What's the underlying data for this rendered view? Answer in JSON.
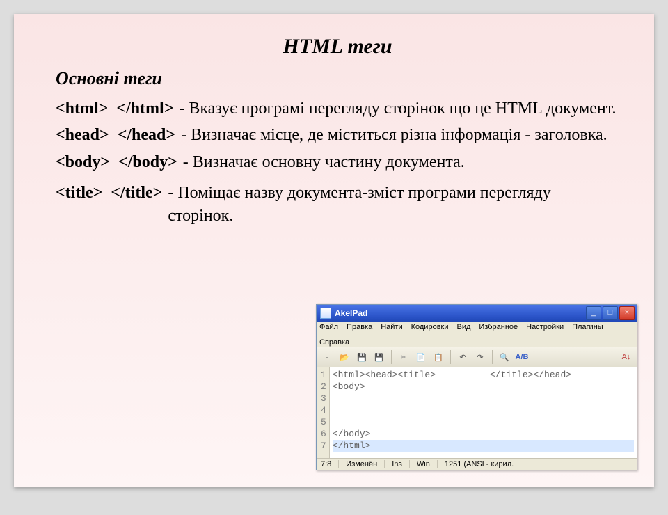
{
  "title": "HTML теги",
  "subtitle": "Основні теги",
  "items": [
    {
      "tags": "<html>  </html>",
      "desc": "- Вказує програмі перегляду сторінок що це HTML документ."
    },
    {
      "tags": "<head>  </head>",
      "desc": "- Визначає місце, де міститься різна інформація - заголовка."
    },
    {
      "tags": "<body>  </body>",
      "desc": "- Визначає основну частину документа."
    },
    {
      "tags": "",
      "desc": ""
    },
    {
      "tags": "<title>  </title>",
      "desc": "- Поміщає назву документа-зміст програми перегляду сторінок."
    }
  ],
  "app": {
    "window_title": "AkelPad",
    "menu": [
      "Файл",
      "Правка",
      "Найти",
      "Кодировки",
      "Вид",
      "Избранное",
      "Настройки",
      "Плагины",
      "Справка"
    ],
    "line_numbers": [
      "1",
      "2",
      "3",
      "4",
      "5",
      "6",
      "7"
    ],
    "lines": [
      "<html><head><title>          </title></head>",
      "<body>",
      "",
      "",
      "",
      "</body>",
      "</html>"
    ],
    "status": {
      "pos": "7:8",
      "mod": "Изменён",
      "ins": "Ins",
      "platform": "Win",
      "enc": "1251 (ANSI - кирил."
    }
  }
}
